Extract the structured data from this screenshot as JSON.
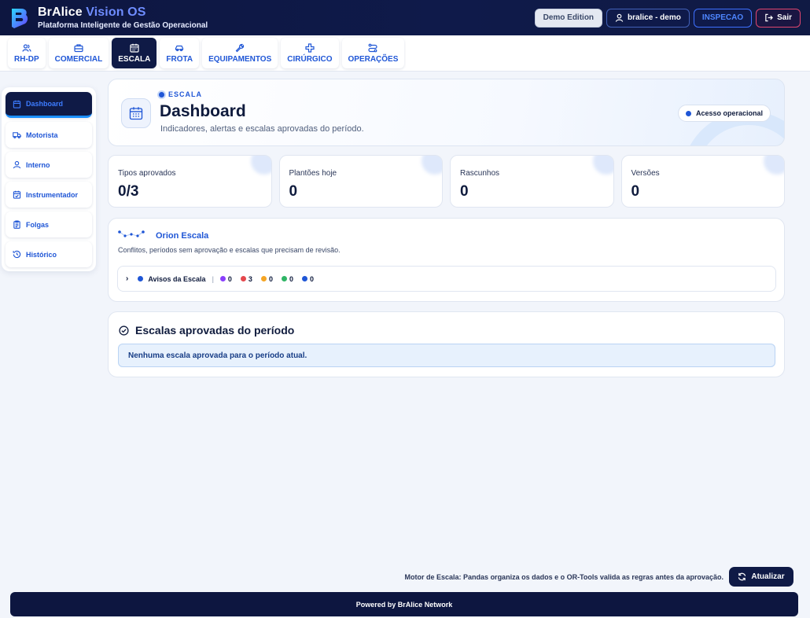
{
  "header": {
    "brand_main": "BrAlice",
    "brand_accent": "Vision OS",
    "subtitle": "Plataforma Inteligente de Gestão Operacional",
    "demo_label": "Demo Edition",
    "user_label": "bralice - demo",
    "role_label": "INSPECAO",
    "logout_label": "Sair"
  },
  "tabs": [
    {
      "label": "RH-DP",
      "icon": "users-icon"
    },
    {
      "label": "COMERCIAL",
      "icon": "briefcase-icon"
    },
    {
      "label": "ESCALA",
      "icon": "calendar-icon",
      "active": true
    },
    {
      "label": "FROTA",
      "icon": "car-icon"
    },
    {
      "label": "EQUIPAMENTOS",
      "icon": "wrench-icon"
    },
    {
      "label": "CIRÚRGICO",
      "icon": "plus-cross-icon"
    },
    {
      "label": "OPERAÇÕES",
      "icon": "route-icon"
    }
  ],
  "sidebar": {
    "items": [
      {
        "label": "Dashboard",
        "icon": "calendar-icon",
        "active": true
      },
      {
        "label": "Motorista",
        "icon": "truck-icon"
      },
      {
        "label": "Interno",
        "icon": "user-icon"
      },
      {
        "label": "Instrumentador",
        "icon": "calendar-check-icon"
      },
      {
        "label": "Folgas",
        "icon": "clipboard-icon"
      },
      {
        "label": "Histórico",
        "icon": "history-icon"
      }
    ]
  },
  "hero": {
    "kicker": "ESCALA",
    "title": "Dashboard",
    "subtitle": "Indicadores, alertas e escalas aprovadas do período.",
    "access_label": "Acesso operacional"
  },
  "stats": [
    {
      "label": "Tipos aprovados",
      "value": "0/3"
    },
    {
      "label": "Plantões hoje",
      "value": "0"
    },
    {
      "label": "Rascunhos",
      "value": "0"
    },
    {
      "label": "Versões",
      "value": "0"
    }
  ],
  "orion": {
    "title": "Orion Escala",
    "subtitle": "Conflitos, períodos sem aprovação e escalas que precisam de revisão.",
    "avisos_label": "Avisos da Escala",
    "counts": [
      {
        "color": "#8a3ffc",
        "value": "0"
      },
      {
        "color": "#e5484d",
        "value": "3"
      },
      {
        "color": "#f5a524",
        "value": "0"
      },
      {
        "color": "#30b566",
        "value": "0"
      },
      {
        "color": "#1f56d6",
        "value": "0"
      }
    ]
  },
  "approved": {
    "title": "Escalas aprovadas do período",
    "empty_message": "Nenhuma escala aprovada para o período atual."
  },
  "engine_note": "Motor de Escala: Pandas organiza os dados e o OR-Tools valida as regras antes da aprovação.",
  "refresh_label": "Atualizar",
  "footer": "Powered by BrAlice Network",
  "colors": {
    "navy": "#0f1a46",
    "accent": "#1f56d6",
    "brand_accent": "#6f8dff"
  }
}
